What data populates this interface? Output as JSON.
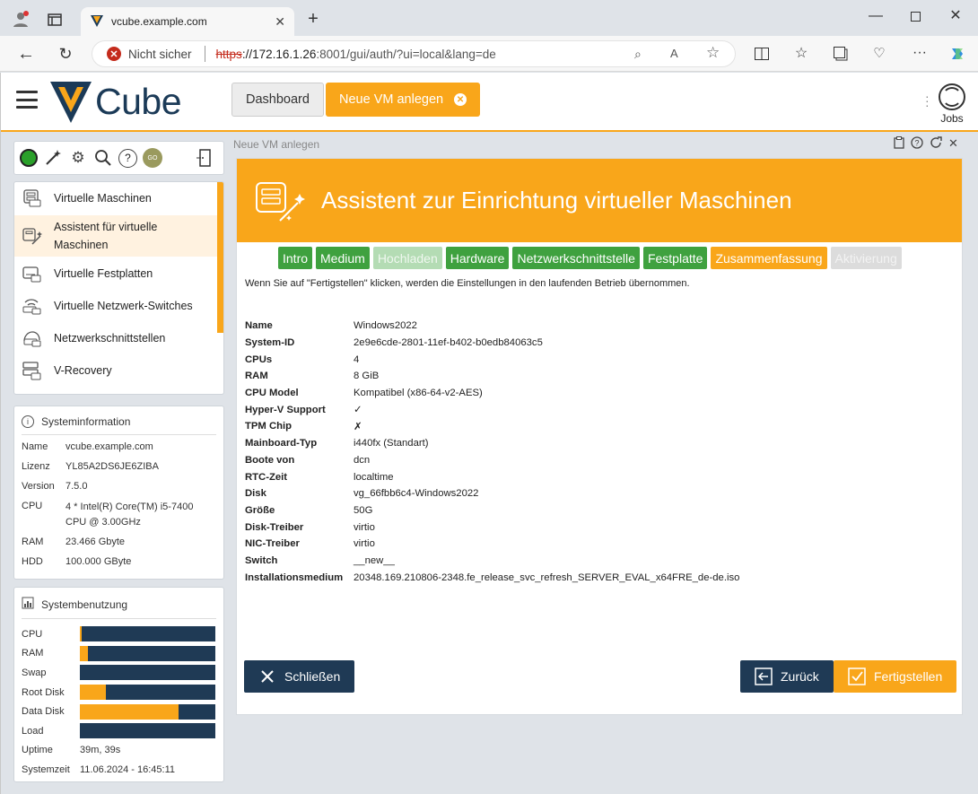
{
  "browser": {
    "tab_title": "vcube.example.com",
    "not_secure_label": "Nicht sicher",
    "url_scheme": "https",
    "url_host": "://172.16.1.26",
    "url_rest": ":8001/gui/auth/?ui=local&lang=de"
  },
  "header": {
    "logo_text": "Cube",
    "dashboard_label": "Dashboard",
    "new_vm_label": "Neue VM anlegen",
    "jobs_label": "Jobs"
  },
  "nav": {
    "items": [
      {
        "label": "Virtuelle Maschinen"
      },
      {
        "label": "Assistent für virtuelle Maschinen"
      },
      {
        "label": "Virtuelle Festplatten"
      },
      {
        "label": "Virtuelle Netzwerk-Switches"
      },
      {
        "label": "Netzwerkschnittstellen"
      },
      {
        "label": "V-Recovery"
      }
    ]
  },
  "sysinfo": {
    "title": "Systeminformation",
    "rows": [
      {
        "k": "Name",
        "v": "vcube.example.com"
      },
      {
        "k": "Lizenz",
        "v": "YL85A2DS6JE6ZIBA"
      },
      {
        "k": "Version",
        "v": "7.5.0"
      },
      {
        "k": "CPU",
        "v": "4 * Intel(R) Core(TM) i5-7400 CPU @ 3.00GHz"
      },
      {
        "k": "RAM",
        "v": "23.466 Gbyte"
      },
      {
        "k": "HDD",
        "v": "100.000 GByte"
      }
    ]
  },
  "usage": {
    "title": "Systembenutzung",
    "bars": [
      {
        "k": "CPU",
        "fill": 0.01
      },
      {
        "k": "RAM",
        "fill": 0.06
      },
      {
        "k": "Swap",
        "fill": 0.0
      },
      {
        "k": "Root Disk",
        "fill": 0.19
      },
      {
        "k": "Data Disk",
        "fill": 0.73
      },
      {
        "k": "Load",
        "fill": 0.0
      }
    ],
    "uptime_label": "Uptime",
    "uptime_value": "39m, 39s",
    "systime_label": "Systemzeit",
    "systime_value": "11.06.2024 - 16:45:11"
  },
  "main": {
    "breadcrumb": "Neue VM anlegen",
    "title": "Assistent zur Einrichtung virtueller Maschinen",
    "steps": [
      {
        "label": "Intro",
        "state": "done"
      },
      {
        "label": "Medium",
        "state": "done"
      },
      {
        "label": "Hochladen",
        "state": "light"
      },
      {
        "label": "Hardware",
        "state": "done"
      },
      {
        "label": "Netzwerkschnittstelle",
        "state": "done"
      },
      {
        "label": "Festplatte",
        "state": "done"
      },
      {
        "label": "Zusammenfassung",
        "state": "current"
      },
      {
        "label": "Aktivierung",
        "state": "disabled"
      }
    ],
    "hint": "Wenn Sie auf \"Fertigstellen\" klicken, werden die Einstellungen in den laufenden Betrieb übernommen.",
    "summary": [
      {
        "k": "Name",
        "v": "Windows2022"
      },
      {
        "k": "System-ID",
        "v": "2e9e6cde-2801-11ef-b402-b0edb84063c5"
      },
      {
        "k": "CPUs",
        "v": "4"
      },
      {
        "k": "RAM",
        "v": "8 GiB"
      },
      {
        "k": "CPU Model",
        "v": "Kompatibel (x86-64-v2-AES)"
      },
      {
        "k": "Hyper-V Support",
        "v": "✓"
      },
      {
        "k": "TPM Chip",
        "v": "✗"
      },
      {
        "k": "Mainboard-Typ",
        "v": "i440fx (Standart)"
      },
      {
        "k": "Boote von",
        "v": "dcn"
      },
      {
        "k": "RTC-Zeit",
        "v": "localtime"
      },
      {
        "k": "Disk",
        "v": "vg_66fbb6c4-Windows2022"
      },
      {
        "k": "Größe",
        "v": "50G"
      },
      {
        "k": "Disk-Treiber",
        "v": "virtio"
      },
      {
        "k": "NIC-Treiber",
        "v": "virtio"
      },
      {
        "k": "Switch",
        "v": "__new__"
      },
      {
        "k": "Installationsmedium",
        "v": "20348.169.210806-2348.fe_release_svc_refresh_SERVER_EVAL_x64FRE_de-de.iso"
      }
    ],
    "close_label": "Schließen",
    "back_label": "Zurück",
    "finish_label": "Fertigstellen"
  },
  "colors": {
    "accent": "#f9a61a",
    "navy": "#1f3a55",
    "green": "#3fa13f"
  }
}
